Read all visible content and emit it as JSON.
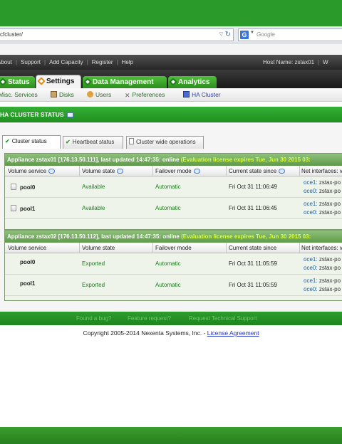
{
  "browser": {
    "url": "cfcluster/",
    "search_placeholder": "Google",
    "search_engine_icon": "G"
  },
  "topnav": {
    "links": [
      "About",
      "Support",
      "Add Capacity",
      "Register",
      "Help"
    ],
    "hostname": "Host Name: zstax01",
    "trailing": "W"
  },
  "tabs": {
    "status": "Status",
    "settings": "Settings",
    "data_management": "Data Management",
    "analytics": "Analytics"
  },
  "subnav": {
    "misc": "Misc. Services",
    "disks": "Disks",
    "users": "Users",
    "preferences": "Preferences",
    "ha_cluster": "HA Cluster"
  },
  "page_title": "HA CLUSTER STATUS",
  "subtabs": {
    "cluster_status": "Cluster status",
    "heartbeat": "Heartbeat status",
    "cluster_ops": "Cluster wide operations"
  },
  "columns": {
    "volume_service": "Volume service",
    "volume_state": "Volume state",
    "failover_mode": "Failover mode",
    "current_state": "Current state since",
    "net_interfaces": "Net interfaces: v"
  },
  "appliances": [
    {
      "header": "Appliance zstax01 [176.13.50.111], last updated 14:47:35: online",
      "license": "(Evaluation license expires Tue, Jun 30 2015 03:",
      "rows": [
        {
          "pool": "pool0",
          "state": "Available",
          "failover": "Automatic",
          "since": "Fri Oct 31 11:06:49",
          "net1": "oce1:",
          "net1v": "zstax-po",
          "net2": "oce0:",
          "net2v": "zstax-po"
        },
        {
          "pool": "pool1",
          "state": "Available",
          "failover": "Automatic",
          "since": "Fri Oct 31 11:06:45",
          "net1": "oce1:",
          "net1v": "zstax-po",
          "net2": "oce0:",
          "net2v": "zstax-po"
        }
      ]
    },
    {
      "header": "Appliance zstax02 [176.13.50.112], last updated 14:47:35: online",
      "license": "(Evaluation license expires Tue, Jun 30 2015 03:",
      "rows": [
        {
          "pool": "pool0",
          "state": "Exported",
          "failover": "Automatic",
          "since": "Fri Oct 31 11:05:59",
          "net1": "oce1:",
          "net1v": "zstax-po",
          "net2": "oce0:",
          "net2v": "zstax-po"
        },
        {
          "pool": "pool1",
          "state": "Exported",
          "failover": "Automatic",
          "since": "Fri Oct 31 11:05:59",
          "net1": "oce1:",
          "net1v": "zstax-po",
          "net2": "oce0:",
          "net2v": "zstax-po"
        }
      ]
    }
  ],
  "footer": {
    "bug": "Found a bug?",
    "feature": "Feature request?",
    "support": "Request Technical Support"
  },
  "copyright": {
    "text": "Copyright 2005-2014 Nexenta Systems, Inc. - ",
    "link": "License Agreement"
  }
}
